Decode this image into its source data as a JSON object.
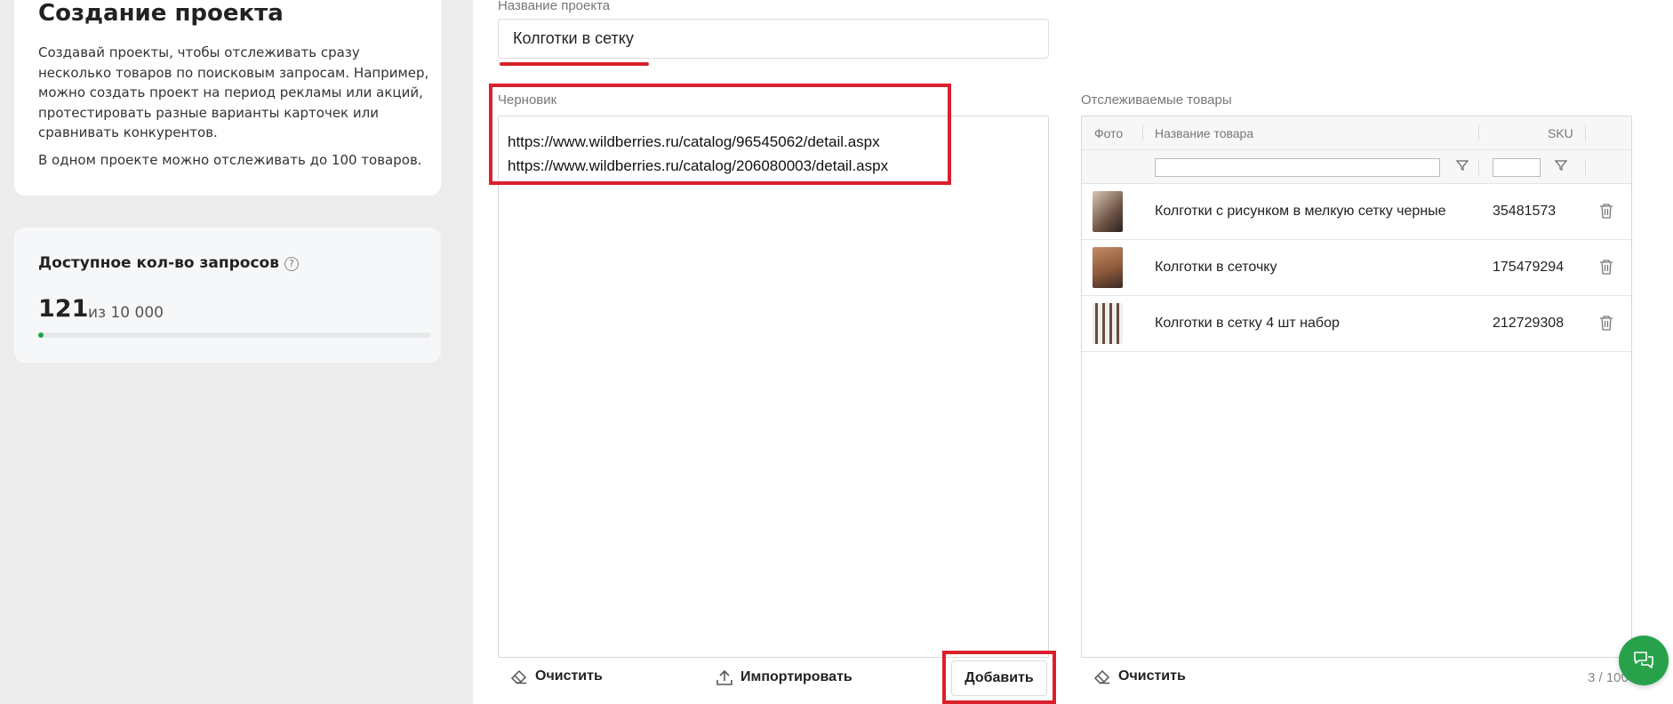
{
  "info": {
    "title": "Создание проекта",
    "description": "Создавай проекты, чтобы отслеживать сразу несколько товаров по поисковым запросам. Например, можно создать проект на период рекламы или акций, протестировать разные варианты карточек или сравнивать конкурентов.",
    "limit_note": "В одном проекте можно отслеживать до 100 товаров."
  },
  "quota": {
    "title": "Доступное кол-во запросов",
    "help_icon": "?",
    "used": "121",
    "total_label": "из 10 000",
    "progress_fraction": 0.0121
  },
  "project_name": {
    "label": "Название проекта",
    "value": "Колготки в сетку"
  },
  "draft": {
    "label": "Черновик",
    "lines": [
      "https://www.wildberries.ru/catalog/96545062/detail.aspx",
      "https://www.wildberries.ru/catalog/206080003/detail.aspx"
    ],
    "clear_label": "Очистить",
    "import_label": "Импортировать",
    "add_label": "Добавить"
  },
  "tracked": {
    "label": "Отслеживаемые товары",
    "columns": {
      "photo": "Фото",
      "name": "Название товара",
      "sku": "SKU"
    },
    "rows": [
      {
        "name": "Колготки с рисунком в мелкую сетку черные",
        "sku": "35481573"
      },
      {
        "name": "Колготки в сеточку",
        "sku": "175479294"
      },
      {
        "name": "Колготки в сетку 4 шт набор",
        "sku": "212729308"
      }
    ],
    "clear_label": "Очистить",
    "counter": "3 / 100"
  },
  "colors": {
    "accent_green": "#27a24b",
    "highlight_red": "#d9202c"
  }
}
